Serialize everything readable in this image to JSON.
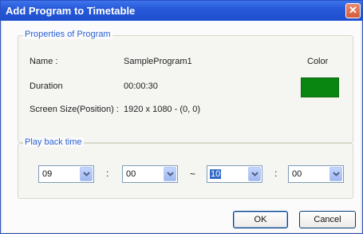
{
  "window": {
    "title": "Add Program to Timetable",
    "close_glyph": "✕"
  },
  "properties": {
    "legend": "Properties of Program",
    "name_label": "Name :",
    "name_value": "SampleProgram1",
    "color_label": "Color",
    "color_value": "#098512",
    "duration_label": "Duration",
    "duration_value": "00:00:30",
    "screen_label": "Screen Size(Position) :",
    "screen_value": "1920 x 1080 - (0, 0)"
  },
  "playback": {
    "legend": "Play back time",
    "start_hour": "09",
    "start_minute": "00",
    "range_sep": "~",
    "time_sep": ":",
    "end_hour": "10",
    "end_minute": "00"
  },
  "buttons": {
    "ok": "OK",
    "cancel": "Cancel"
  }
}
